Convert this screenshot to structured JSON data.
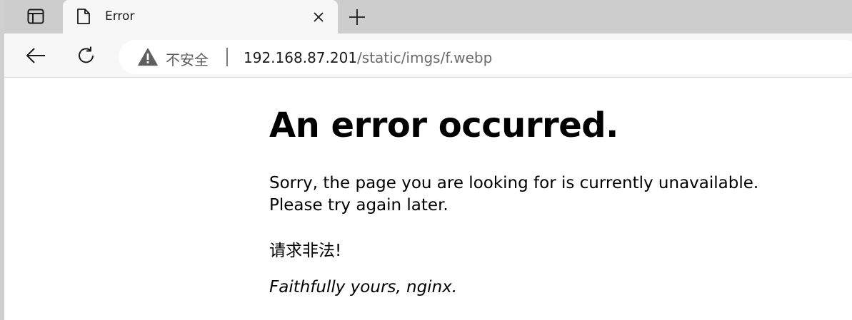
{
  "tab": {
    "title": "Error",
    "page_icon": "page-icon",
    "close_icon": "close-icon"
  },
  "toolbar": {
    "back_icon": "back-arrow-icon",
    "reload_icon": "reload-icon",
    "new_tab_icon": "plus-icon",
    "tab_actions_icon": "tab-actions-icon"
  },
  "omnibox": {
    "security_label": "不安全",
    "security_icon": "warning-icon",
    "url_host": "192.168.87.201",
    "url_path": "/static/imgs/f.webp"
  },
  "page": {
    "heading": "An error occurred.",
    "message_line1": "Sorry, the page you are looking for is currently unavailable.",
    "message_line2": "Please try again later.",
    "illegal_request": "请求非法!",
    "signature": "Faithfully yours, nginx."
  },
  "colors": {
    "tabstrip": "#cdcdcd",
    "toolbar": "#f7f7f7",
    "url_path": "#6a6a6a"
  }
}
